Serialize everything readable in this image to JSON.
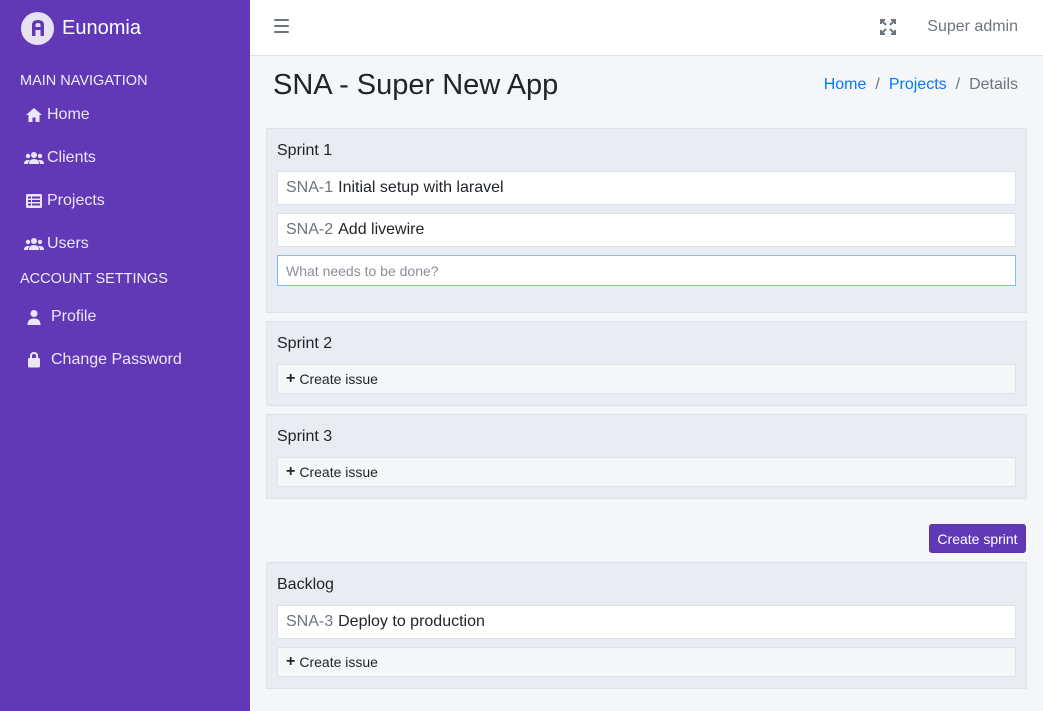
{
  "app": {
    "name": "Eunomia"
  },
  "sidebar": {
    "headers": [
      "MAIN NAVIGATION",
      "ACCOUNT SETTINGS"
    ],
    "main_items": [
      {
        "label": "Home",
        "icon": "home-icon"
      },
      {
        "label": "Clients",
        "icon": "users-icon"
      },
      {
        "label": "Projects",
        "icon": "list-icon"
      },
      {
        "label": "Users",
        "icon": "users-icon"
      }
    ],
    "account_items": [
      {
        "label": "Profile",
        "icon": "user-icon"
      },
      {
        "label": "Change Password",
        "icon": "lock-icon"
      }
    ]
  },
  "topbar": {
    "user": "Super admin"
  },
  "page": {
    "title": "SNA - Super New App",
    "breadcrumb": [
      "Home",
      "Projects",
      "Details"
    ]
  },
  "sprints": [
    {
      "name": "Sprint 1",
      "issues": [
        {
          "key": "SNA-1",
          "title": "Initial setup with laravel"
        },
        {
          "key": "SNA-2",
          "title": "Add livewire"
        }
      ],
      "input_placeholder": "What needs to be done?"
    },
    {
      "name": "Sprint 2",
      "create_label": "Create issue"
    },
    {
      "name": "Sprint 3",
      "create_label": "Create issue"
    }
  ],
  "create_sprint_label": "Create sprint",
  "backlog": {
    "name": "Backlog",
    "issues": [
      {
        "key": "SNA-3",
        "title": "Deploy to production"
      }
    ],
    "create_label": "Create issue"
  },
  "colors": {
    "accent": "#6139b7",
    "link": "#007bff",
    "card_bg": "#e9ecf3"
  }
}
